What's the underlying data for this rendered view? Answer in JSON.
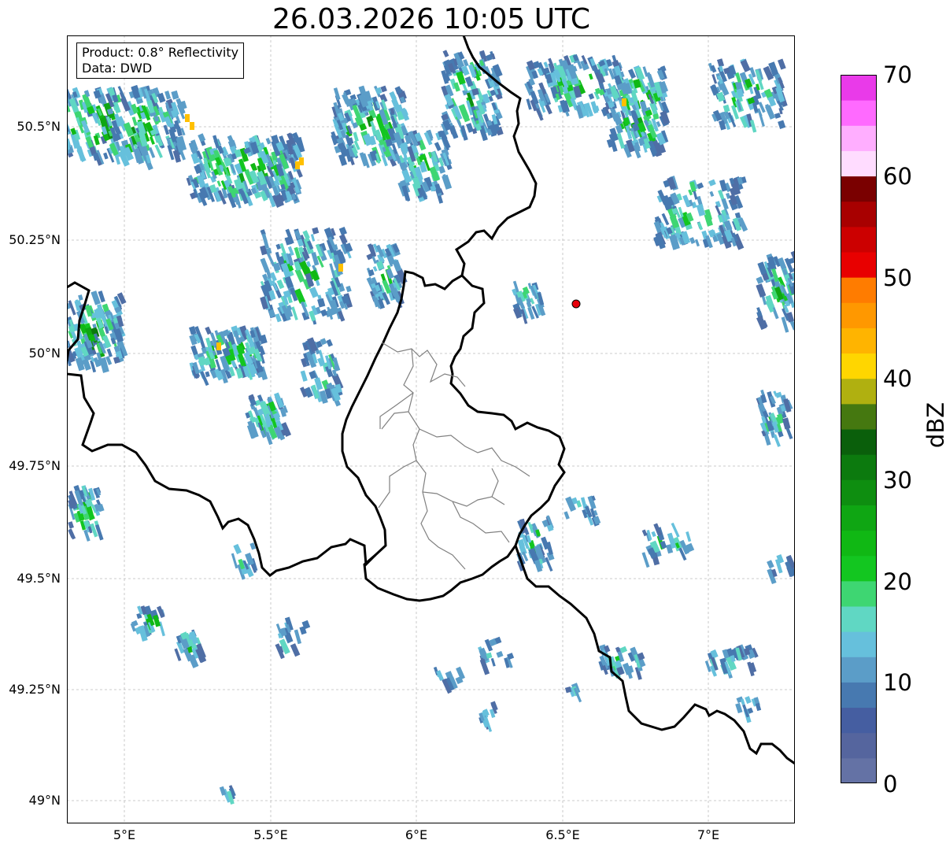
{
  "title": "26.03.2026 10:05 UTC",
  "infobox": {
    "product": "Product: 0.8° Reflectivity",
    "source": "Data: DWD"
  },
  "map": {
    "lat_ticks": [
      "50.5°N",
      "50.25°N",
      "50°N",
      "49.75°N",
      "49.5°N",
      "49.25°N",
      "49°N"
    ],
    "lon_ticks": [
      "5°E",
      "5.5°E",
      "6°E",
      "6.5°E",
      "7°E"
    ],
    "gridlines": "on",
    "marker": {
      "name": "radar-site",
      "color": "#e8000b"
    }
  },
  "colorbar": {
    "label": "dBZ",
    "ticks": [
      "0",
      "10",
      "20",
      "30",
      "40",
      "50",
      "60",
      "70"
    ],
    "min": 0,
    "max": 70,
    "colors": [
      "#6472a5",
      "#55659e",
      "#455ea1",
      "#4779b0",
      "#5b9dc8",
      "#66c0dc",
      "#60d7c3",
      "#3ed672",
      "#13c620",
      "#10b814",
      "#0fa613",
      "#0e8e10",
      "#0c7a0e",
      "#0a5f0b",
      "#457810",
      "#b0b010",
      "#ffd600",
      "#ffb400",
      "#ff9800",
      "#ff7c00",
      "#e80000",
      "#cc0000",
      "#a80000",
      "#7a0000",
      "#ffdcff",
      "#ffaeff",
      "#ff6aff",
      "#e93ae9"
    ]
  }
}
